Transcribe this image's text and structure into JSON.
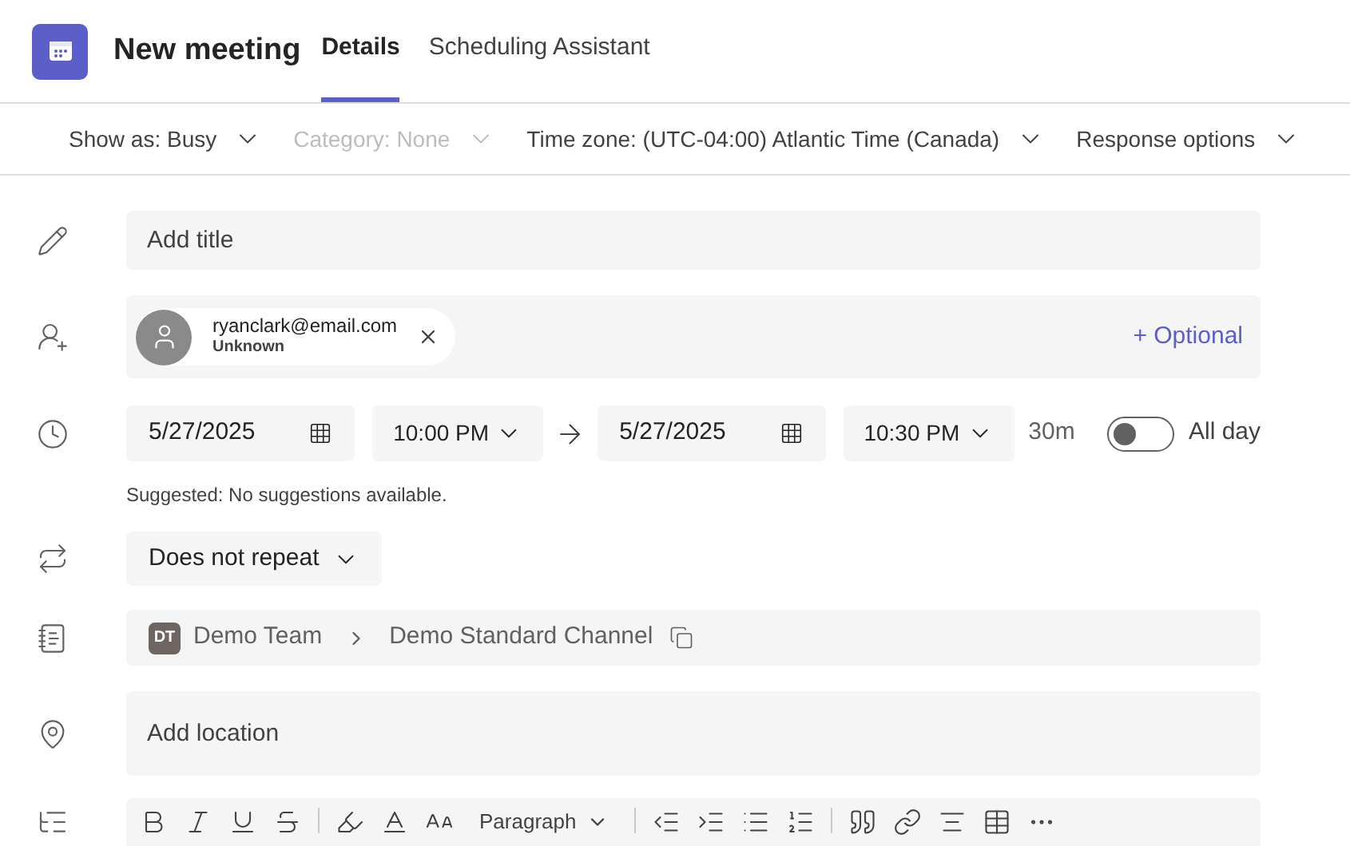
{
  "header": {
    "title": "New meeting",
    "tabs": [
      {
        "label": "Details",
        "selected": true
      },
      {
        "label": "Scheduling Assistant",
        "selected": false
      }
    ]
  },
  "options_bar": [
    {
      "label": "Show as: Busy",
      "disabled": false
    },
    {
      "label": "Category: None",
      "disabled": true
    },
    {
      "label": "Time zone: (UTC-04:00) Atlantic Time (Canada)",
      "disabled": false
    },
    {
      "label": "Response options",
      "disabled": false
    }
  ],
  "title_field": {
    "placeholder": "Add title"
  },
  "attendees": {
    "people": [
      {
        "email": "ryanclark@email.com",
        "status": "Unknown"
      }
    ],
    "optional_link": "+ Optional"
  },
  "time": {
    "start_date": "5/27/2025",
    "start_time": "10:00 PM",
    "end_date": "5/27/2025",
    "end_time": "10:30 PM",
    "duration": "30m",
    "all_day": {
      "label": "All day",
      "on": false
    },
    "suggestion": "Suggested: No suggestions available."
  },
  "repeat": {
    "value": "Does not repeat"
  },
  "channel": {
    "team_initials": "DT",
    "team": "Demo Team",
    "channel": "Demo Standard Channel"
  },
  "location": {
    "placeholder": "Add location"
  },
  "editor_toolbar": {
    "paragraph_style": "Paragraph"
  }
}
